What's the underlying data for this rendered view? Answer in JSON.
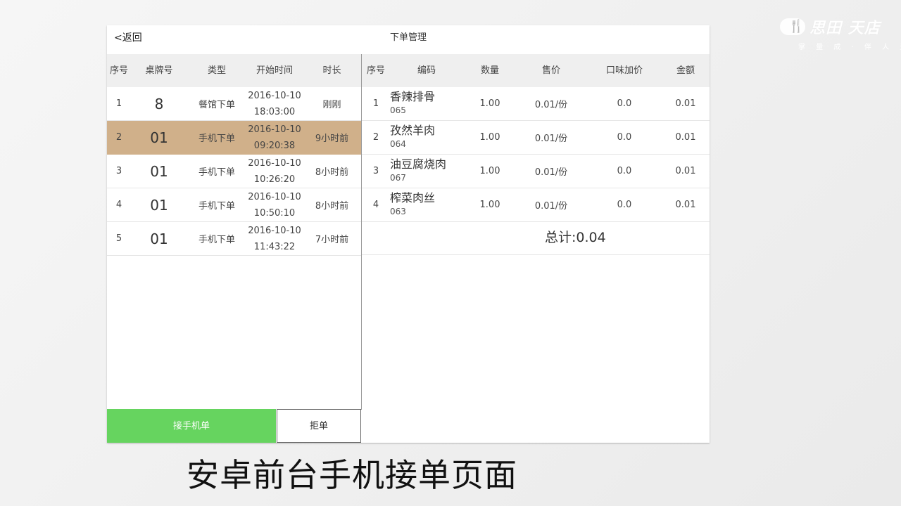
{
  "brand": {
    "name": "思田 天店",
    "tagline": "掌 量 成 · 伴 人 无"
  },
  "header": {
    "back_label": "<返回",
    "title": "下单管理"
  },
  "orders": {
    "columns": [
      "序号",
      "桌牌号",
      "类型",
      "开始时间",
      "时长"
    ],
    "rows": [
      {
        "index": "1",
        "table": "8",
        "type": "餐馆下单",
        "date": "2016-10-10",
        "time": "18:03:00",
        "duration": "刚刚"
      },
      {
        "index": "2",
        "table": "01",
        "type": "手机下单",
        "date": "2016-10-10",
        "time": "09:20:38",
        "duration": "9小时前"
      },
      {
        "index": "3",
        "table": "01",
        "type": "手机下单",
        "date": "2016-10-10",
        "time": "10:26:20",
        "duration": "8小时前"
      },
      {
        "index": "4",
        "table": "01",
        "type": "手机下单",
        "date": "2016-10-10",
        "time": "10:50:10",
        "duration": "8小时前"
      },
      {
        "index": "5",
        "table": "01",
        "type": "手机下单",
        "date": "2016-10-10",
        "time": "11:43:22",
        "duration": "7小时前"
      }
    ],
    "selected_index": 1,
    "accept_label": "接手机单",
    "reject_label": "拒单"
  },
  "details": {
    "columns": [
      "序号",
      "编码",
      "数量",
      "售价",
      "口味加价",
      "金额"
    ],
    "rows": [
      {
        "index": "1",
        "name": "香辣排骨",
        "code": "065",
        "qty": "1.00",
        "price": "0.01/份",
        "extra": "0.0",
        "amount": "0.01"
      },
      {
        "index": "2",
        "name": "孜然羊肉",
        "code": "064",
        "qty": "1.00",
        "price": "0.01/份",
        "extra": "0.0",
        "amount": "0.01"
      },
      {
        "index": "3",
        "name": "油豆腐烧肉",
        "code": "067",
        "qty": "1.00",
        "price": "0.01/份",
        "extra": "0.0",
        "amount": "0.01"
      },
      {
        "index": "4",
        "name": "榨菜肉丝",
        "code": "063",
        "qty": "1.00",
        "price": "0.01/份",
        "extra": "0.0",
        "amount": "0.01"
      }
    ],
    "total": "总计:0.04"
  },
  "caption": "安卓前台手机接单页面",
  "colors": {
    "accent_green": "#66d45f",
    "selected_row": "#d0b08a",
    "header_bg": "#efefef"
  }
}
